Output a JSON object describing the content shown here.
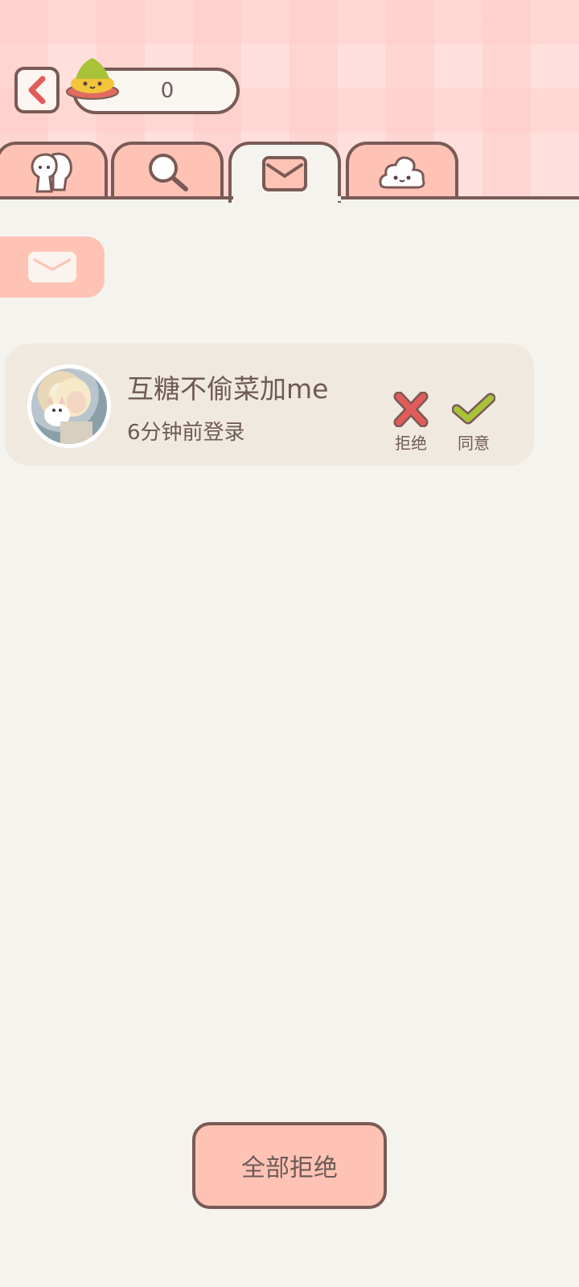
{
  "header": {
    "coin_count": "0"
  },
  "tabs": [
    {
      "name": "friends",
      "icon": "friends-icon"
    },
    {
      "name": "search",
      "icon": "search-icon"
    },
    {
      "name": "mail",
      "icon": "mail-icon",
      "active": true
    },
    {
      "name": "poop",
      "icon": "poop-icon"
    }
  ],
  "requests": [
    {
      "name": "互糖不偷菜加me",
      "login_time": "6分钟前登录",
      "reject_label": "拒绝",
      "accept_label": "同意"
    }
  ],
  "footer": {
    "reject_all_label": "全部拒绝"
  },
  "colors": {
    "accent_pink": "#ffc3b6",
    "outline": "#7a5a55",
    "background": "#f5f3ee",
    "card": "#f0e9df",
    "reject_red": "#e25b5b",
    "accept_green": "#a8c23a"
  }
}
